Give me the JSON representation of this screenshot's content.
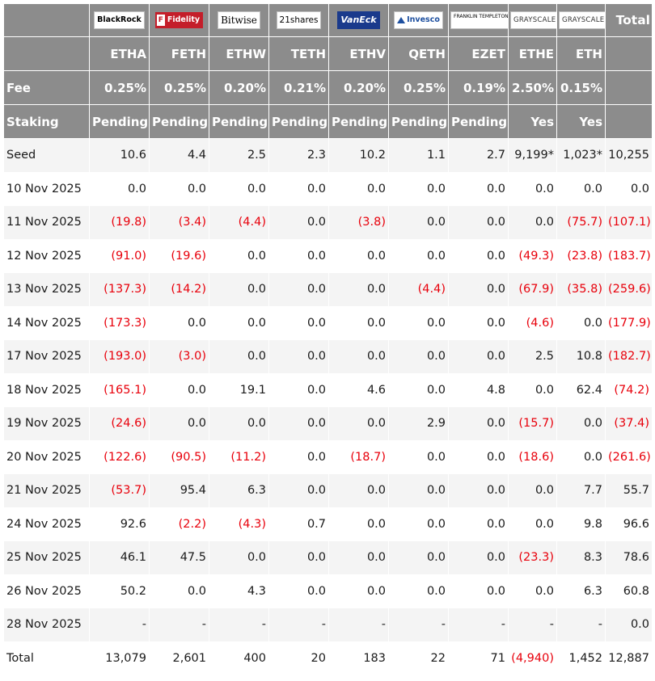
{
  "logos": {
    "corner": "",
    "blackrock": "BlackRock",
    "fidelity": "Fidelity",
    "bitwise": "Bitwise",
    "shares21": "21shares",
    "vaneck": "VanEck",
    "invesco": "Invesco",
    "franklin": "FRANKLIN TEMPLETON",
    "grayscale_ethe": "GRAYSCALE",
    "grayscale_eth": "GRAYSCALE",
    "total": "Total"
  },
  "tickers": [
    "ETHA",
    "FETH",
    "ETHW",
    "TETH",
    "ETHV",
    "QETH",
    "EZET",
    "ETHE",
    "ETH"
  ],
  "fee": {
    "label": "Fee",
    "values": [
      "0.25%",
      "0.25%",
      "0.20%",
      "0.21%",
      "0.20%",
      "0.25%",
      "0.19%",
      "2.50%",
      "0.15%"
    ]
  },
  "staking": {
    "label": "Staking",
    "values": [
      "Pending",
      "Pending",
      "Pending",
      "Pending",
      "Pending",
      "Pending",
      "Pending",
      "Yes",
      "Yes"
    ]
  },
  "rows": [
    {
      "label": "Seed",
      "values": [
        "10.6",
        "4.4",
        "2.5",
        "2.3",
        "10.2",
        "1.1",
        "2.7",
        "9,199*",
        "1,023*",
        "10,255"
      ]
    },
    {
      "label": "10 Nov 2025",
      "values": [
        "0.0",
        "0.0",
        "0.0",
        "0.0",
        "0.0",
        "0.0",
        "0.0",
        "0.0",
        "0.0",
        "0.0"
      ]
    },
    {
      "label": "11 Nov 2025",
      "values": [
        "(19.8)",
        "(3.4)",
        "(4.4)",
        "0.0",
        "(3.8)",
        "0.0",
        "0.0",
        "0.0",
        "(75.7)",
        "(107.1)"
      ]
    },
    {
      "label": "12 Nov 2025",
      "values": [
        "(91.0)",
        "(19.6)",
        "0.0",
        "0.0",
        "0.0",
        "0.0",
        "0.0",
        "(49.3)",
        "(23.8)",
        "(183.7)"
      ]
    },
    {
      "label": "13 Nov 2025",
      "values": [
        "(137.3)",
        "(14.2)",
        "0.0",
        "0.0",
        "0.0",
        "(4.4)",
        "0.0",
        "(67.9)",
        "(35.8)",
        "(259.6)"
      ]
    },
    {
      "label": "14 Nov 2025",
      "values": [
        "(173.3)",
        "0.0",
        "0.0",
        "0.0",
        "0.0",
        "0.0",
        "0.0",
        "(4.6)",
        "0.0",
        "(177.9)"
      ]
    },
    {
      "label": "17 Nov 2025",
      "values": [
        "(193.0)",
        "(3.0)",
        "0.0",
        "0.0",
        "0.0",
        "0.0",
        "0.0",
        "2.5",
        "10.8",
        "(182.7)"
      ]
    },
    {
      "label": "18 Nov 2025",
      "values": [
        "(165.1)",
        "0.0",
        "19.1",
        "0.0",
        "4.6",
        "0.0",
        "4.8",
        "0.0",
        "62.4",
        "(74.2)"
      ]
    },
    {
      "label": "19 Nov 2025",
      "values": [
        "(24.6)",
        "0.0",
        "0.0",
        "0.0",
        "0.0",
        "2.9",
        "0.0",
        "(15.7)",
        "0.0",
        "(37.4)"
      ]
    },
    {
      "label": "20 Nov 2025",
      "values": [
        "(122.6)",
        "(90.5)",
        "(11.2)",
        "0.0",
        "(18.7)",
        "0.0",
        "0.0",
        "(18.6)",
        "0.0",
        "(261.6)"
      ]
    },
    {
      "label": "21 Nov 2025",
      "values": [
        "(53.7)",
        "95.4",
        "6.3",
        "0.0",
        "0.0",
        "0.0",
        "0.0",
        "0.0",
        "7.7",
        "55.7"
      ]
    },
    {
      "label": "24 Nov 2025",
      "values": [
        "92.6",
        "(2.2)",
        "(4.3)",
        "0.7",
        "0.0",
        "0.0",
        "0.0",
        "0.0",
        "9.8",
        "96.6"
      ]
    },
    {
      "label": "25 Nov 2025",
      "values": [
        "46.1",
        "47.5",
        "0.0",
        "0.0",
        "0.0",
        "0.0",
        "0.0",
        "(23.3)",
        "8.3",
        "78.6"
      ]
    },
    {
      "label": "26 Nov 2025",
      "values": [
        "50.2",
        "0.0",
        "4.3",
        "0.0",
        "0.0",
        "0.0",
        "0.0",
        "0.0",
        "6.3",
        "60.8"
      ]
    },
    {
      "label": "28 Nov 2025",
      "values": [
        "-",
        "-",
        "-",
        "-",
        "-",
        "-",
        "-",
        "-",
        "-",
        "0.0"
      ]
    },
    {
      "label": "Total",
      "values": [
        "13,079",
        "2,601",
        "400",
        "20",
        "183",
        "22",
        "71",
        "(4,940)",
        "1,452",
        "12,887"
      ]
    }
  ],
  "colors": {
    "header_bg": "#8c8c8c",
    "negative": "#e8000b",
    "highlight_row": "#a2fc98",
    "seed_total_bg": "#e7ecf7"
  }
}
